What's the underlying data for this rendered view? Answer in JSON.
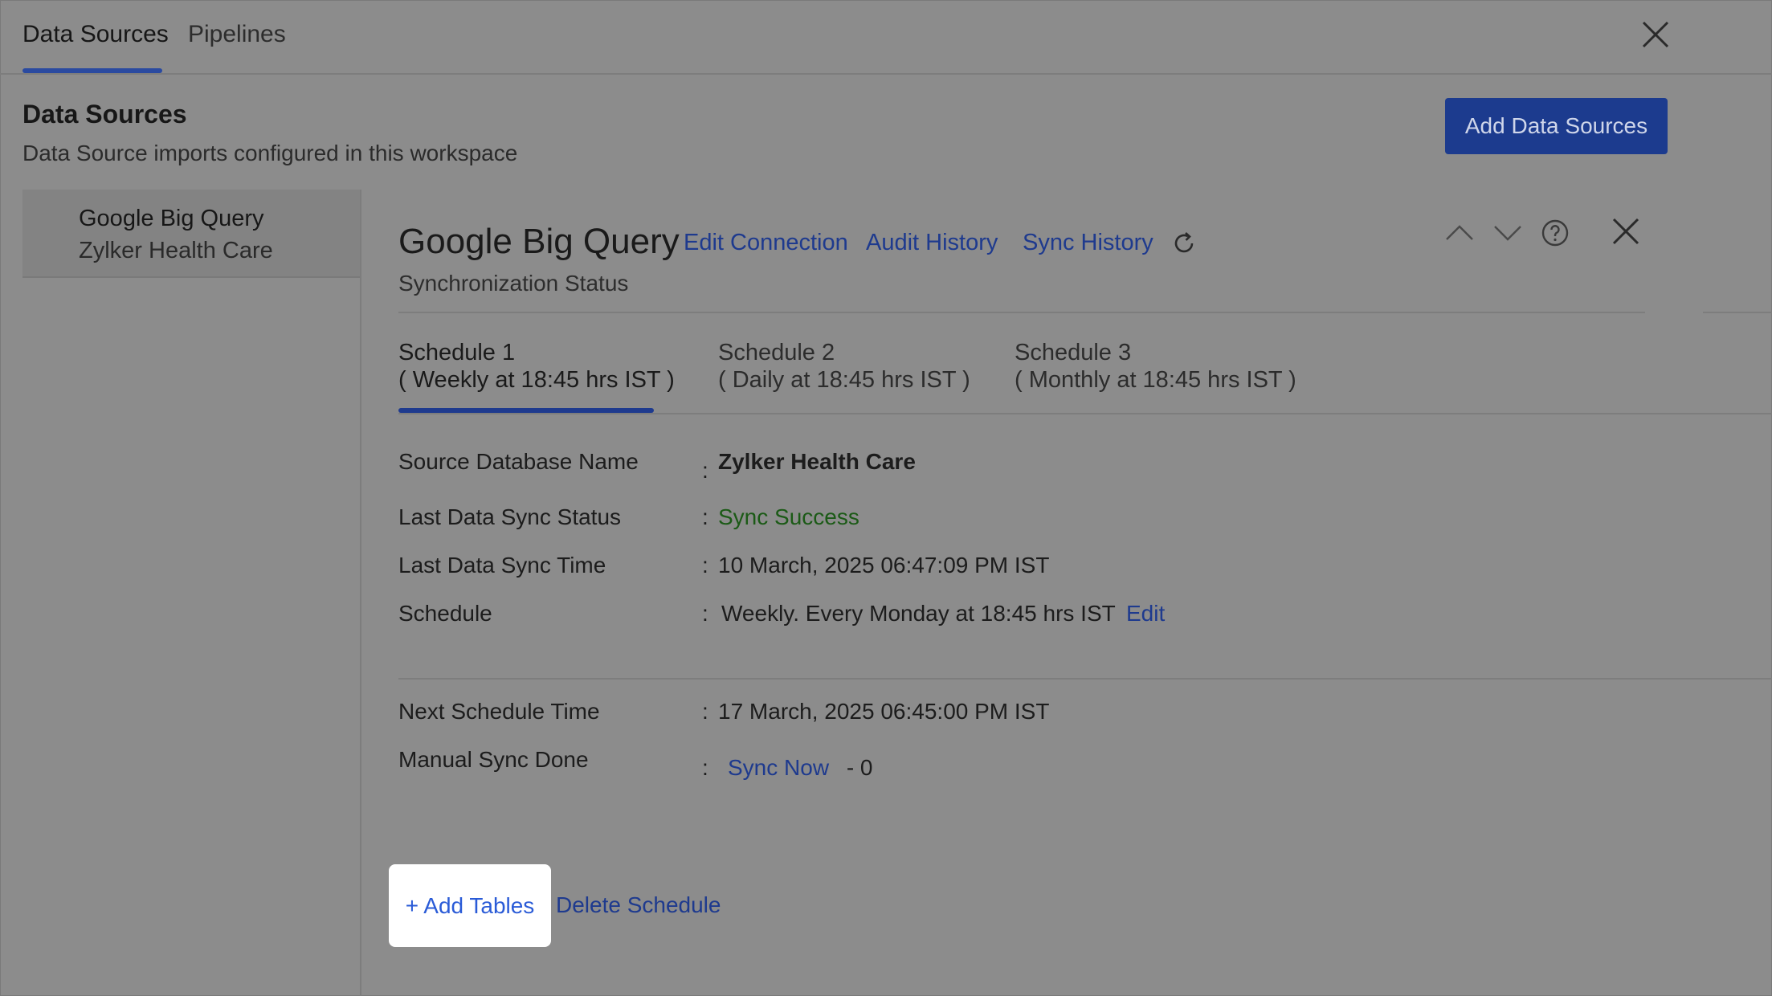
{
  "top_tabs": [
    {
      "label": "Data Sources",
      "active": true
    },
    {
      "label": "Pipelines",
      "active": false
    }
  ],
  "header": {
    "title": "Data Sources",
    "subtitle": "Data Source imports configured in this workspace",
    "add_button": "Add Data Sources"
  },
  "sidebar": {
    "items": [
      {
        "name": "Google Big Query",
        "sub": "Zylker Health Care",
        "selected": true
      }
    ]
  },
  "detail": {
    "title": "Google Big Query",
    "links": {
      "edit_connection": "Edit Connection",
      "audit_history": "Audit History",
      "sync_history": "Sync History"
    },
    "subtitle": "Synchronization Status",
    "schedules": [
      {
        "name": "Schedule 1",
        "desc": "( Weekly at 18:45 hrs IST )",
        "active": true
      },
      {
        "name": "Schedule 2",
        "desc": "( Daily at 18:45 hrs IST )",
        "active": false
      },
      {
        "name": "Schedule 3",
        "desc": "( Monthly at 18:45 hrs IST )",
        "active": false
      }
    ],
    "fields": {
      "source_db": {
        "label": "Source Database Name",
        "value": "Zylker Health Care"
      },
      "last_status": {
        "label": "Last Data Sync Status",
        "value": "Sync Success"
      },
      "last_time": {
        "label": "Last Data Sync Time",
        "value": "10 March, 2025 06:47:09 PM IST"
      },
      "schedule": {
        "label": "Schedule",
        "value": "Weekly. Every Monday at 18:45 hrs IST",
        "edit": "Edit"
      },
      "next_time": {
        "label": "Next Schedule Time",
        "value": "17 March, 2025 06:45:00 PM IST"
      },
      "manual_sync": {
        "label": "Manual Sync Done",
        "link": "Sync Now",
        "count": "- 0"
      }
    },
    "colon": ":",
    "actions": {
      "add_tables": "+ Add Tables",
      "delete_schedule": "Delete Schedule"
    }
  },
  "colors": {
    "accent": "#1e3a8e",
    "success": "#1b5a16",
    "overlay_bg": "#8c8c8c",
    "highlight": "#ffffff"
  },
  "icons": [
    "close-icon",
    "refresh-icon",
    "chevron-up-icon",
    "chevron-down-icon",
    "help-icon",
    "close-panel-icon"
  ]
}
